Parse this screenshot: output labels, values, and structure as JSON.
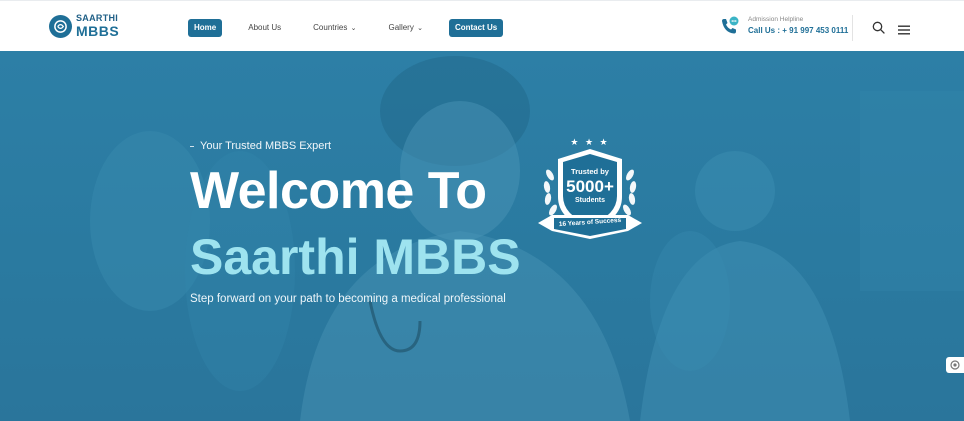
{
  "brand": {
    "name_top": "SAARTHI",
    "name_bottom": "MBBS",
    "primary_color": "#1f6f97",
    "accent_color": "#9ee3ef"
  },
  "nav": {
    "items": [
      {
        "label": "Home",
        "active": true
      },
      {
        "label": "About Us",
        "active": false
      },
      {
        "label": "Countries",
        "has_dropdown": true,
        "chevron": "⌄"
      },
      {
        "label": "Gallery",
        "has_dropdown": true,
        "chevron": "⌄"
      },
      {
        "label": "Contact Us",
        "cta": true
      }
    ]
  },
  "helpline": {
    "label": "Admission Helpline",
    "number": "Call Us : + 91 997 453 0111",
    "icon": "phone-icon"
  },
  "header_icons": [
    "search-icon",
    "hamburger-menu-icon"
  ],
  "hero": {
    "tagline": "Your Trusted MBBS Expert",
    "headline_line1": "Welcome To",
    "headline_line2": "Saarthi MBBS",
    "subheadline": "Step forward on your path to becoming a medical professional"
  },
  "badge": {
    "top_text": "Trusted by",
    "number": "5000+",
    "bottom_text": "Students",
    "ribbon_text": "16 Years of Success",
    "stars": "★ ★ ★"
  }
}
